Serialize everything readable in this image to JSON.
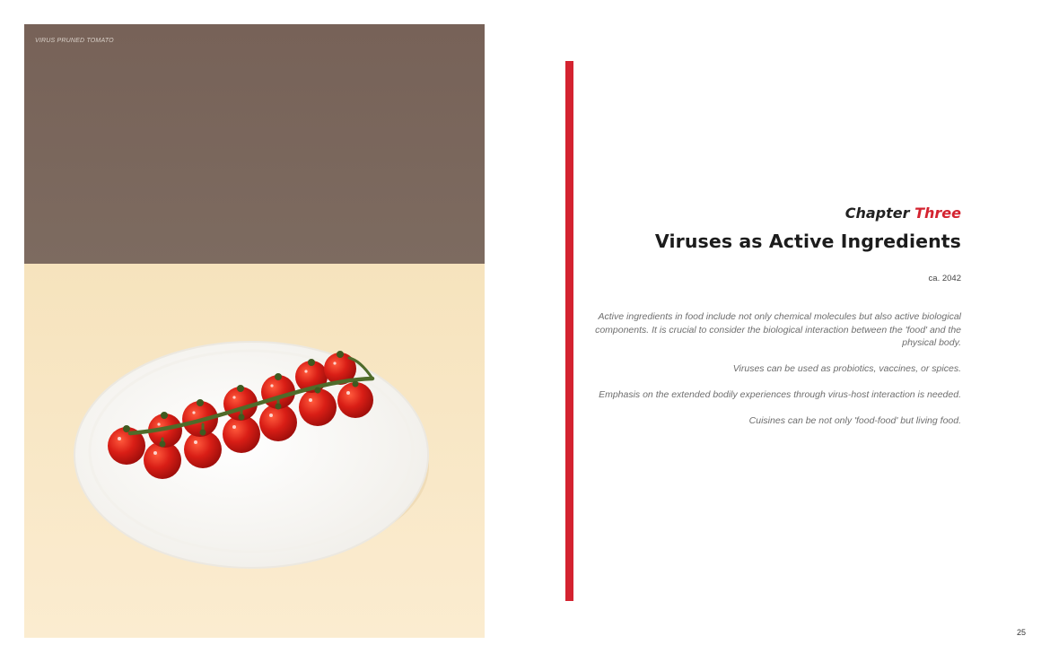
{
  "photo": {
    "caption": "VIRUS PRUNED TOMATO",
    "colors": {
      "wall": "#7a675d",
      "table": "#f8e7c4",
      "plate": "#fbfaf7",
      "tomato": "#d41f1a",
      "stem": "#4f6b2a"
    }
  },
  "chapter": {
    "label": "Chapter",
    "number": "Three"
  },
  "title": "Viruses as Active Ingredients",
  "date": "ca. 2042",
  "paragraphs": [
    "Active ingredients in food include not only chemical molecules but also active biological components. It is crucial to consider the biological interaction between the 'food' and the physical body.",
    "Viruses can be used as probiotics, vaccines, or spices.",
    "Emphasis on the extended bodily experiences through virus-host interaction is needed.",
    "Cuisines can be not only 'food-food' but living food."
  ],
  "page_number": "25",
  "accent_color": "#d42330"
}
